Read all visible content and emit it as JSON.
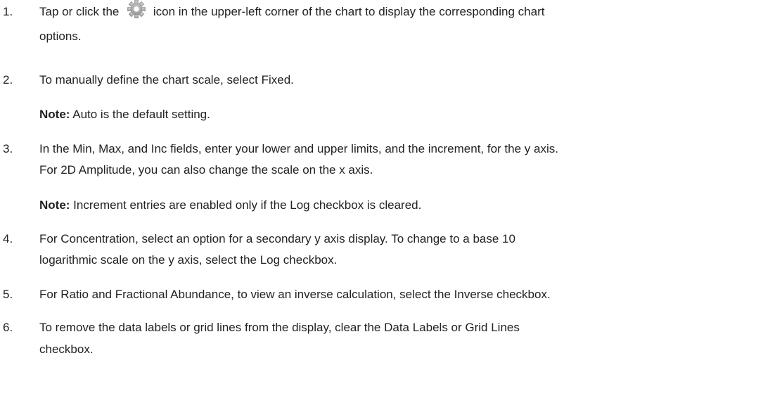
{
  "steps": [
    {
      "num": "1.",
      "line1_before": "Tap or click the",
      "icon": "gear-icon",
      "line1_after": "icon in the upper-left corner of the chart to display the corresponding chart",
      "line2": "options."
    },
    {
      "num": "2.",
      "line1": "To manually define the chart scale, select Fixed.",
      "note_label": "Note:",
      "note_text": " Auto is the default setting."
    },
    {
      "num": "3.",
      "line1": "In the Min, Max, and Inc fields, enter your lower and upper limits, and the increment, for the y axis.",
      "line2": "For 2D Amplitude, you can also change the scale on the x axis.",
      "note_label": "Note:",
      "note_text": " Increment entries are enabled only if the Log checkbox is cleared."
    },
    {
      "num": "4.",
      "line1": "For Concentration, select an option for a secondary y axis display. To change to a base 10",
      "line2": "logarithmic scale on the y axis, select the Log checkbox."
    },
    {
      "num": "5.",
      "line1": "For Ratio and Fractional Abundance, to view an inverse calculation, select the Inverse checkbox."
    },
    {
      "num": "6.",
      "line1": "To remove the data labels or grid lines from the display, clear the Data Labels or Grid Lines",
      "line2": "checkbox."
    }
  ]
}
